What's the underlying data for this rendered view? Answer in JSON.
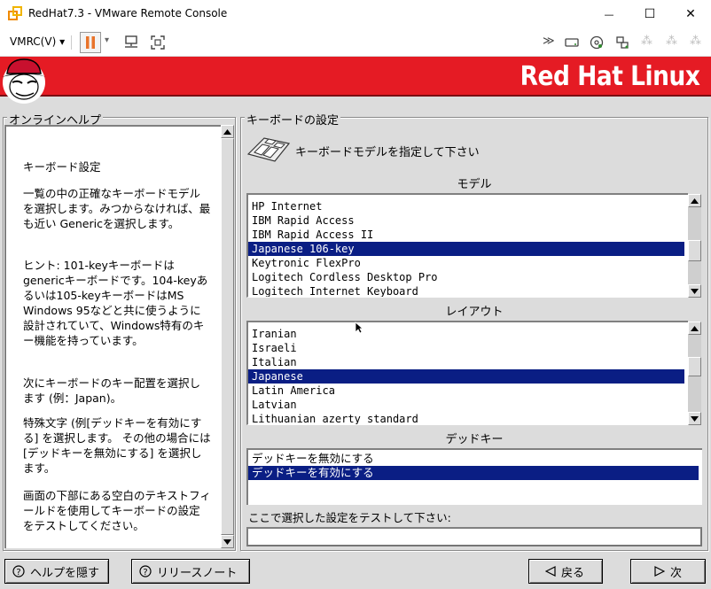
{
  "window": {
    "title": "RedHat7.3 - VMware Remote Console",
    "minimize_glyph": "—",
    "maximize_glyph": "☐",
    "close_glyph": "✕"
  },
  "toolbar": {
    "vmrc_menu": "VMRC(V) ▾",
    "pause_dropdown": "▾",
    "right_icons": [
      "fast-forward-icon",
      "hard-disk-icon",
      "cd-icon",
      "network-icon",
      "device-icon",
      "device-icon",
      "device-icon"
    ]
  },
  "banner": {
    "brand": "Red Hat Linux"
  },
  "help": {
    "title": "オンラインヘルプ",
    "paragraphs": [
      "キーボード設定",
      "一覧の中の正確なキーボードモデルを選択します。みつからなければ、最も近い Genericを選択します。",
      "ヒント: 101-keyキーボードはgenericキーボードです。104-keyあるいは105-keyキーボードはMS Windows 95などと共に使うように設計されていて、Windows特有のキー機能を持っています。",
      "次にキーボードのキー配置を選択します (例：Japan)。",
      "特殊文字 (例[デッドキーを有効にする] を選択します。 その他の場合には[デッドキーを無効にする] を選択します。",
      "画面の下部にある空白のテキストフィールドを使用してキーボードの設定をテストしてください。"
    ]
  },
  "settings": {
    "title": "キーボードの設定",
    "heading": "キーボードモデルを指定して下さい",
    "model_label": "モデル",
    "models": [
      "HP Internet",
      "IBM Rapid Access",
      "IBM Rapid Access II",
      "Japanese 106-key",
      "Keytronic FlexPro",
      "Logitech Cordless Desktop Pro",
      "Logitech Internet Keyboard"
    ],
    "model_selected": 3,
    "layout_label": "レイアウト",
    "layouts": [
      "Iranian",
      "Israeli",
      "Italian",
      "Japanese",
      "Latin America",
      "Latvian",
      "Lithuanian azerty standard"
    ],
    "layout_selected": 3,
    "deadkey_label": "デッドキー",
    "deadkeys": [
      "デッドキーを無効にする",
      "デッドキーを有効にする"
    ],
    "deadkey_selected": 1,
    "test_label": "ここで選択した設定をテストして下さい:",
    "test_value": ""
  },
  "buttons": {
    "hide_help": "ヘルプを隠す",
    "release_notes": "リリースノート",
    "back": "戻る",
    "next": "次"
  },
  "colors": {
    "banner_red": "#e51b24",
    "selection_blue": "#0a1e84",
    "panel_gray": "#dcdcdc"
  }
}
